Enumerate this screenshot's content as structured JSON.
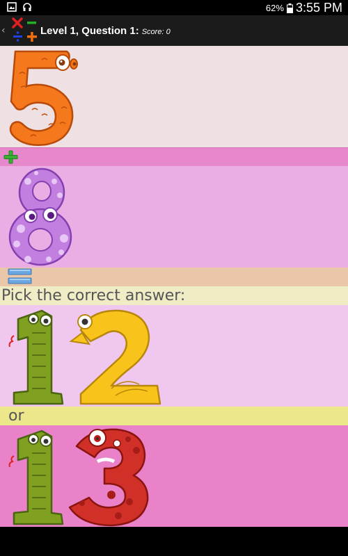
{
  "status_bar": {
    "battery": "62%",
    "time": "3:55 PM"
  },
  "action_bar": {
    "title": "Level 1, Question 1:",
    "score": "Score: 0"
  },
  "question": {
    "first_number": 5,
    "operator": "plus",
    "second_number": 8,
    "equals": "equals"
  },
  "prompt": "Pick the correct answer:",
  "answers": {
    "option_a": 12,
    "separator": "or",
    "option_b": 13
  },
  "colors": {
    "panel_1": "#efe0e4",
    "operator_band": "#e888cc",
    "panel_2": "#eaaee4",
    "equals_band": "#ebc7a9",
    "prompt_band": "#efecc6",
    "panel_3": "#efc7ef",
    "or_band": "#ece78a",
    "panel_4": "#e982c8"
  }
}
